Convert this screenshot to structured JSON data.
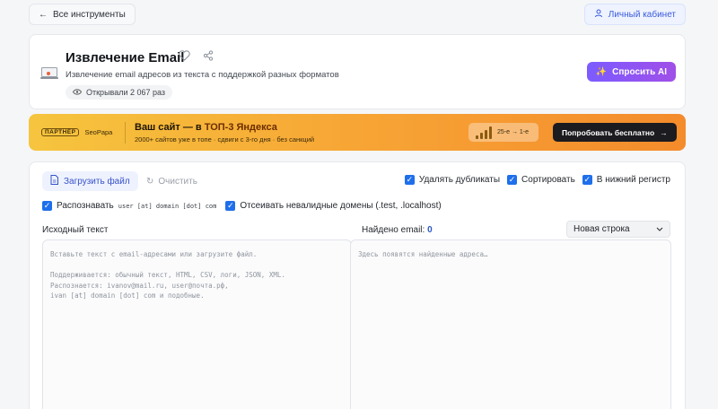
{
  "topbar": {
    "back_label": "Все инструменты",
    "account_label": "Личный кабинет"
  },
  "header": {
    "title": "Извлечение Email",
    "description": "Извлечение email адресов из текста с поддержкой разных форматов",
    "views": "Открывали 2 067 раз",
    "ask_ai_label": "Спросить AI"
  },
  "promo": {
    "tag": "ПАРТНЁР",
    "partner": "SeoPapa",
    "title_prefix": "Ваш сайт — в ",
    "title_highlight": "ТОП-3 Яндекса",
    "subtitle": "2000+ сайтов уже в топе · сдвиги с 3-го дня · без санкций",
    "rank_text": "25-е → 1-е",
    "cta": "Попробовать бесплатно"
  },
  "toolbar": {
    "upload_label": "Загрузить файл",
    "clear_label": "Очистить",
    "options": {
      "dedupe": "Удалять дубликаты",
      "sort": "Сортировать",
      "lowercase": "В нижний регистр",
      "recognize_prefix": "Распознавать",
      "recognize_code": "user [at] domain [dot] com",
      "filter_invalid": "Отсеивать невалидные домены (.test, .localhost)"
    }
  },
  "source": {
    "label": "Исходный текст",
    "placeholder": "Вставьте текст с email-адресами или загрузите файл.\n\nПоддерживается: обычный текст, HTML, CSV, логи, JSON, XML.\nРаспознается: ivanov@mail.ru, user@почта.рф,\nivan [at] domain [dot] com и подобные."
  },
  "output": {
    "label_prefix": "Найдено email:",
    "count": "0",
    "separator_selected": "Новая строка",
    "placeholder": "Здесь появятся найденные адреса…"
  },
  "colors": {
    "accent": "#1f6feb",
    "ai_gradient_start": "#7c5cff",
    "ai_gradient_end": "#a04fe8",
    "promo_start": "#f6c53e",
    "promo_end": "#f48b2c"
  }
}
